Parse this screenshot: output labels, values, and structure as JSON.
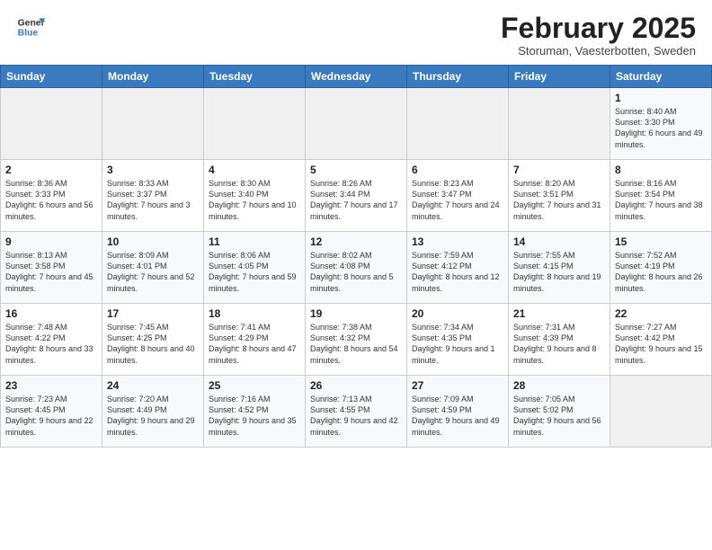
{
  "header": {
    "logo_general": "General",
    "logo_blue": "Blue",
    "month_title": "February 2025",
    "location": "Storuman, Vaesterbotten, Sweden"
  },
  "weekdays": [
    "Sunday",
    "Monday",
    "Tuesday",
    "Wednesday",
    "Thursday",
    "Friday",
    "Saturday"
  ],
  "weeks": [
    [
      {
        "num": "",
        "info": ""
      },
      {
        "num": "",
        "info": ""
      },
      {
        "num": "",
        "info": ""
      },
      {
        "num": "",
        "info": ""
      },
      {
        "num": "",
        "info": ""
      },
      {
        "num": "",
        "info": ""
      },
      {
        "num": "1",
        "info": "Sunrise: 8:40 AM\nSunset: 3:30 PM\nDaylight: 6 hours and 49 minutes."
      }
    ],
    [
      {
        "num": "2",
        "info": "Sunrise: 8:36 AM\nSunset: 3:33 PM\nDaylight: 6 hours and 56 minutes."
      },
      {
        "num": "3",
        "info": "Sunrise: 8:33 AM\nSunset: 3:37 PM\nDaylight: 7 hours and 3 minutes."
      },
      {
        "num": "4",
        "info": "Sunrise: 8:30 AM\nSunset: 3:40 PM\nDaylight: 7 hours and 10 minutes."
      },
      {
        "num": "5",
        "info": "Sunrise: 8:26 AM\nSunset: 3:44 PM\nDaylight: 7 hours and 17 minutes."
      },
      {
        "num": "6",
        "info": "Sunrise: 8:23 AM\nSunset: 3:47 PM\nDaylight: 7 hours and 24 minutes."
      },
      {
        "num": "7",
        "info": "Sunrise: 8:20 AM\nSunset: 3:51 PM\nDaylight: 7 hours and 31 minutes."
      },
      {
        "num": "8",
        "info": "Sunrise: 8:16 AM\nSunset: 3:54 PM\nDaylight: 7 hours and 38 minutes."
      }
    ],
    [
      {
        "num": "9",
        "info": "Sunrise: 8:13 AM\nSunset: 3:58 PM\nDaylight: 7 hours and 45 minutes."
      },
      {
        "num": "10",
        "info": "Sunrise: 8:09 AM\nSunset: 4:01 PM\nDaylight: 7 hours and 52 minutes."
      },
      {
        "num": "11",
        "info": "Sunrise: 8:06 AM\nSunset: 4:05 PM\nDaylight: 7 hours and 59 minutes."
      },
      {
        "num": "12",
        "info": "Sunrise: 8:02 AM\nSunset: 4:08 PM\nDaylight: 8 hours and 5 minutes."
      },
      {
        "num": "13",
        "info": "Sunrise: 7:59 AM\nSunset: 4:12 PM\nDaylight: 8 hours and 12 minutes."
      },
      {
        "num": "14",
        "info": "Sunrise: 7:55 AM\nSunset: 4:15 PM\nDaylight: 8 hours and 19 minutes."
      },
      {
        "num": "15",
        "info": "Sunrise: 7:52 AM\nSunset: 4:19 PM\nDaylight: 8 hours and 26 minutes."
      }
    ],
    [
      {
        "num": "16",
        "info": "Sunrise: 7:48 AM\nSunset: 4:22 PM\nDaylight: 8 hours and 33 minutes."
      },
      {
        "num": "17",
        "info": "Sunrise: 7:45 AM\nSunset: 4:25 PM\nDaylight: 8 hours and 40 minutes."
      },
      {
        "num": "18",
        "info": "Sunrise: 7:41 AM\nSunset: 4:29 PM\nDaylight: 8 hours and 47 minutes."
      },
      {
        "num": "19",
        "info": "Sunrise: 7:38 AM\nSunset: 4:32 PM\nDaylight: 8 hours and 54 minutes."
      },
      {
        "num": "20",
        "info": "Sunrise: 7:34 AM\nSunset: 4:35 PM\nDaylight: 9 hours and 1 minute."
      },
      {
        "num": "21",
        "info": "Sunrise: 7:31 AM\nSunset: 4:39 PM\nDaylight: 9 hours and 8 minutes."
      },
      {
        "num": "22",
        "info": "Sunrise: 7:27 AM\nSunset: 4:42 PM\nDaylight: 9 hours and 15 minutes."
      }
    ],
    [
      {
        "num": "23",
        "info": "Sunrise: 7:23 AM\nSunset: 4:45 PM\nDaylight: 9 hours and 22 minutes."
      },
      {
        "num": "24",
        "info": "Sunrise: 7:20 AM\nSunset: 4:49 PM\nDaylight: 9 hours and 29 minutes."
      },
      {
        "num": "25",
        "info": "Sunrise: 7:16 AM\nSunset: 4:52 PM\nDaylight: 9 hours and 35 minutes."
      },
      {
        "num": "26",
        "info": "Sunrise: 7:13 AM\nSunset: 4:55 PM\nDaylight: 9 hours and 42 minutes."
      },
      {
        "num": "27",
        "info": "Sunrise: 7:09 AM\nSunset: 4:59 PM\nDaylight: 9 hours and 49 minutes."
      },
      {
        "num": "28",
        "info": "Sunrise: 7:05 AM\nSunset: 5:02 PM\nDaylight: 9 hours and 56 minutes."
      },
      {
        "num": "",
        "info": ""
      }
    ]
  ]
}
